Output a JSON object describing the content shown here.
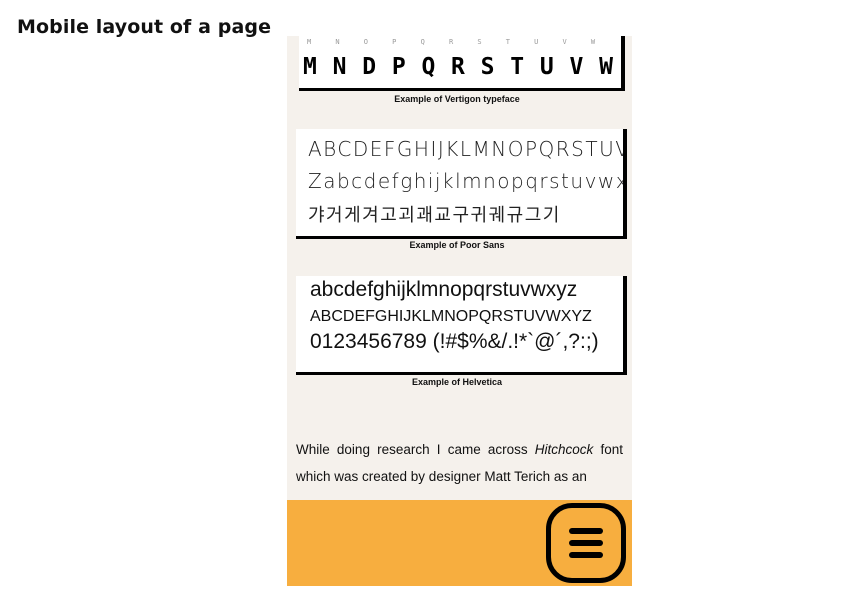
{
  "page": {
    "label": "Mobile layout of a page"
  },
  "vertigon": {
    "small_letters": [
      "M",
      "N",
      "O",
      "P",
      "Q",
      "R",
      "S",
      "T",
      "U",
      "V",
      "W"
    ],
    "big_letters": [
      "M",
      "N",
      "D",
      "P",
      "Q",
      "R",
      "S",
      "T",
      "U",
      "V",
      "W"
    ],
    "caption": "Example of Vertigon typeface"
  },
  "poor_sans": {
    "line1": "ABCDEFGHIJKLMNOPQRSTUVW",
    "line2": "Zabcdefghijklmnopqrstuvwxyz",
    "line3": "갸거게겨고괴괘교구귀궤규그기",
    "caption": "Example of Poor Sans"
  },
  "helvetica": {
    "line1": "abcdefghijklmnopqrstuvwxyz",
    "line2": "ABCDEFGHIJKLMNOPQRSTUVWXYZ",
    "line3": "0123456789 (!#$%&/.!*`@´,?:;)",
    "caption": "Example of Helvetica"
  },
  "article": {
    "text_before": "While doing research I came across ",
    "font_name": "Hitchcock",
    "text_after": " font which was created by designer Matt Terich as an"
  },
  "footer": {
    "menu_icon": "hamburger-menu-icon",
    "color": "#f7ae3f"
  }
}
